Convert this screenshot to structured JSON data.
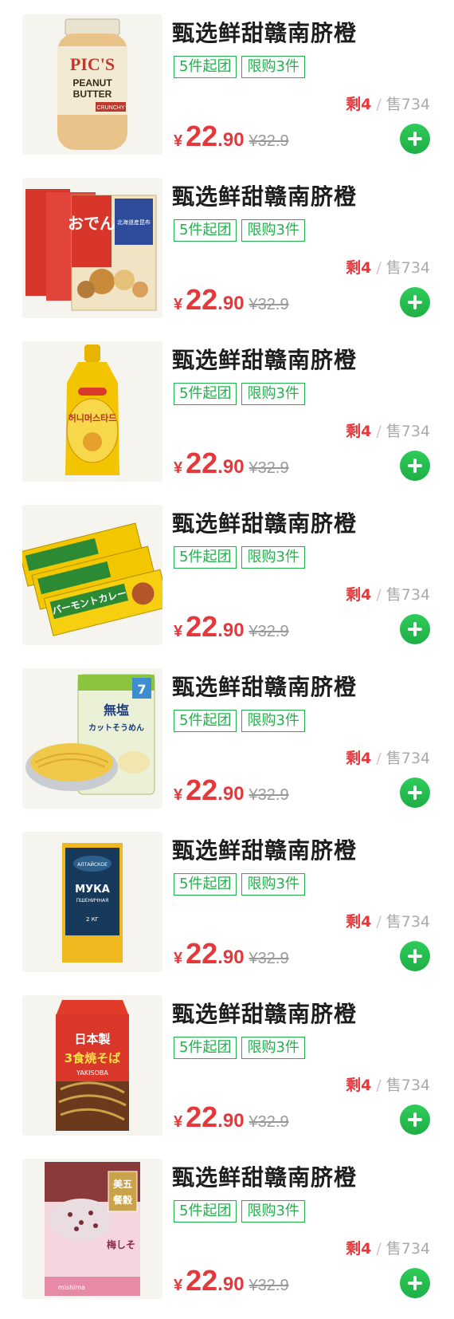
{
  "colors": {
    "accent_green": "#22b14c",
    "price_red": "#e4393c",
    "muted_gray": "#999999"
  },
  "products": [
    {
      "image": "peanut-butter-jar-image",
      "image_text": [
        "PIC'S",
        "PEANUT",
        "BUTTER",
        "CRUNCHY"
      ],
      "title": "甄选鲜甜赣南脐橙",
      "tags": [
        "5件起团",
        "限购3件"
      ],
      "remaining": "剩4",
      "separator": "/",
      "sold": "售734",
      "currency": "¥",
      "price_int": "22",
      "price_dec": ".90",
      "original_price": "¥32.9"
    },
    {
      "image": "oden-soup-boxes-image",
      "image_text": [
        "おでん",
        "北海道産昆布"
      ],
      "title": "甄选鲜甜赣南脐橙",
      "tags": [
        "5件起团",
        "限购3件"
      ],
      "remaining": "剩4",
      "separator": "/",
      "sold": "售734",
      "currency": "¥",
      "price_int": "22",
      "price_dec": ".90",
      "original_price": "¥32.9"
    },
    {
      "image": "honey-mustard-bottle-image",
      "image_text": [
        "허니머스타드"
      ],
      "title": "甄选鲜甜赣南脐橙",
      "tags": [
        "5件起团",
        "限购3件"
      ],
      "remaining": "剩4",
      "separator": "/",
      "sold": "售734",
      "currency": "¥",
      "price_int": "22",
      "price_dec": ".90",
      "original_price": "¥32.9"
    },
    {
      "image": "curry-roux-boxes-image",
      "image_text": [
        "バーモントカレー"
      ],
      "title": "甄选鲜甜赣南脐橙",
      "tags": [
        "5件起团",
        "限购3件"
      ],
      "remaining": "剩4",
      "separator": "/",
      "sold": "售734",
      "currency": "¥",
      "price_int": "22",
      "price_dec": ".90",
      "original_price": "¥32.9"
    },
    {
      "image": "somen-noodle-bag-image",
      "image_text": [
        "無塩",
        "カットそうめん",
        "7"
      ],
      "title": "甄选鲜甜赣南脐橙",
      "tags": [
        "5件起团",
        "限购3件"
      ],
      "remaining": "剩4",
      "separator": "/",
      "sold": "售734",
      "currency": "¥",
      "price_int": "22",
      "price_dec": ".90",
      "original_price": "¥32.9"
    },
    {
      "image": "flour-bag-image",
      "image_text": [
        "АЛТАЙСКОЕ",
        "МУКА",
        "ПШЕНИЧНАЯ",
        "2 КГ"
      ],
      "title": "甄选鲜甜赣南脐橙",
      "tags": [
        "5件起团",
        "限购3件"
      ],
      "remaining": "剩4",
      "separator": "/",
      "sold": "售734",
      "currency": "¥",
      "price_int": "22",
      "price_dec": ".90",
      "original_price": "¥32.9"
    },
    {
      "image": "yakisoba-noodle-pack-image",
      "image_text": [
        "日本製",
        "3食焼そば",
        "YAKISOBA"
      ],
      "title": "甄选鲜甜赣南脐橙",
      "tags": [
        "5件起团",
        "限购3件"
      ],
      "remaining": "剩4",
      "separator": "/",
      "sold": "售734",
      "currency": "¥",
      "price_int": "22",
      "price_dec": ".90",
      "original_price": "¥32.9"
    },
    {
      "image": "five-grain-rice-pack-image",
      "image_text": [
        "美五",
        "餐穀",
        "梅しそ",
        "mishima"
      ],
      "title": "甄选鲜甜赣南脐橙",
      "tags": [
        "5件起团",
        "限购3件"
      ],
      "remaining": "剩4",
      "separator": "/",
      "sold": "售734",
      "currency": "¥",
      "price_int": "22",
      "price_dec": ".90",
      "original_price": "¥32.9"
    }
  ]
}
